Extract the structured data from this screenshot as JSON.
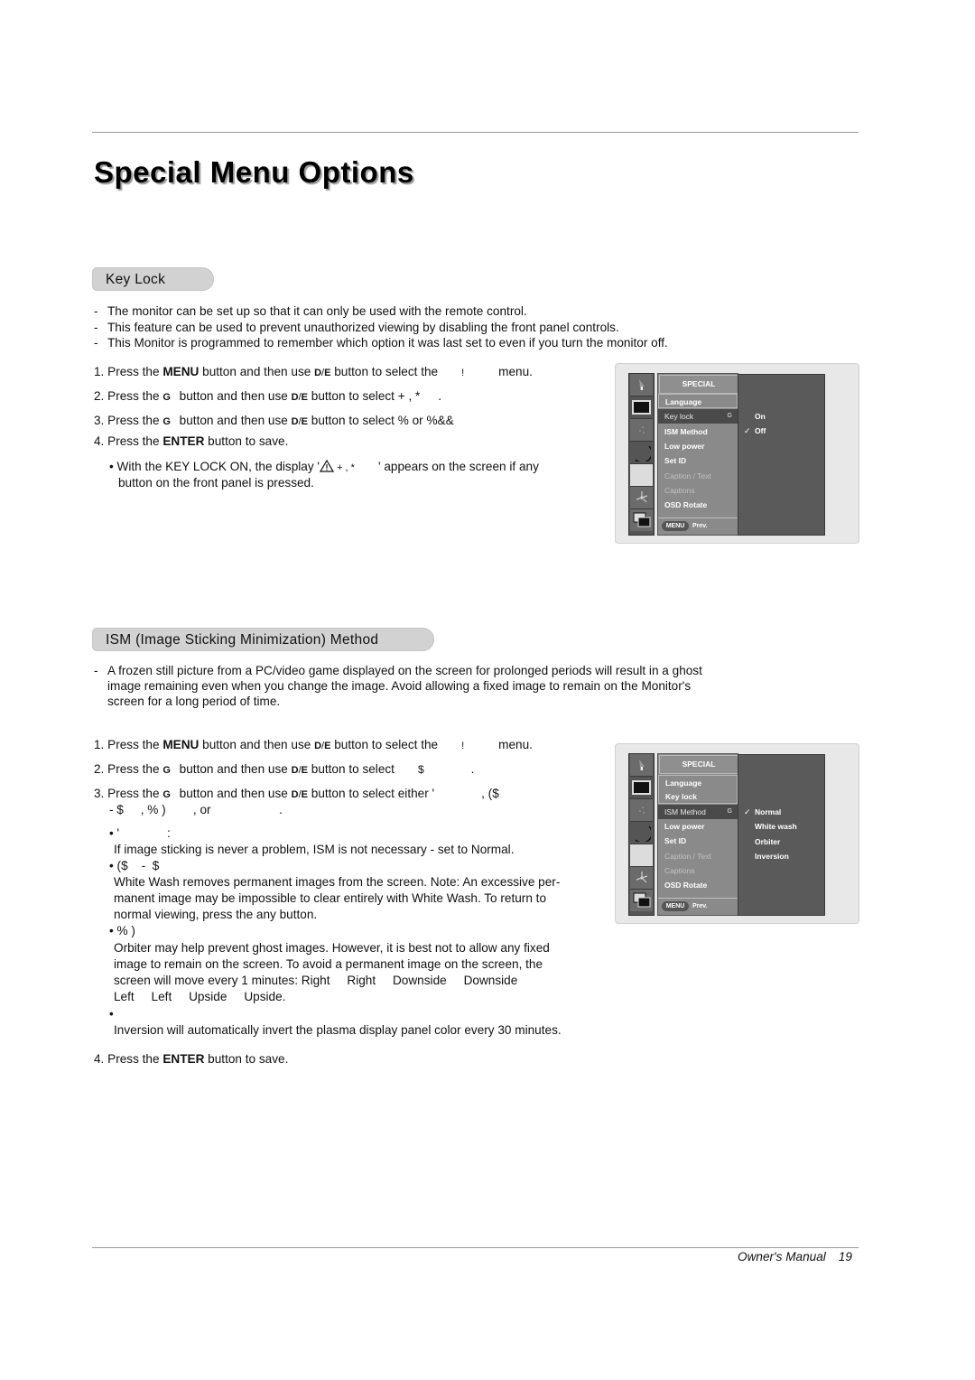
{
  "page": {
    "title": "Special Menu Options",
    "footer_label": "Owner's Manual",
    "page_number": "19"
  },
  "keylock": {
    "heading": "Key Lock",
    "intro": [
      "The monitor can be set up so that it can only be used with the remote control.",
      "This feature can be used to prevent unauthorized viewing by disabling the front panel controls.",
      "This Monitor is programmed to remember which option it was last set to even if you turn the monitor off."
    ],
    "steps": {
      "s1": {
        "num": "1.",
        "a": "Press the ",
        "b": "MENU",
        "c": " button and then use ",
        "k1": "D",
        "sep": " / ",
        "k2": "E",
        "d": " button to select the",
        "e": "!",
        "f": "menu."
      },
      "s2": {
        "num": "2.",
        "a": "Press the ",
        "kg": "G",
        "c": " button and then use ",
        "k1": "D",
        "sep": " / ",
        "k2": "E",
        "d": " button to select + ,   *",
        "f": "."
      },
      "s3": {
        "num": "3.",
        "a": "Press the ",
        "kg": "G",
        "c": " button and then use ",
        "k1": "D",
        "sep": " / ",
        "k2": "E",
        "d": " button to select %   or %&&"
      },
      "s4": {
        "num": "4.",
        "a": "Press the ",
        "b": "ENTER",
        "c": " button to save."
      }
    },
    "note_line1_a": "• With the KEY LOCK ON, the display '",
    "note_line1_b": " + ,   *",
    "note_line1_c": "' appears on the screen if any",
    "note_line2": "button on the front panel is pressed.",
    "osd": {
      "header": "SPECIAL",
      "items": [
        "Language",
        "Key lock",
        "ISM Method",
        "Low power",
        "Set ID",
        "Caption / Text",
        "Captions",
        "OSD Rotate"
      ],
      "selected_marker": "G",
      "options": [
        "On",
        "Off"
      ],
      "checked_option": "Off",
      "check_glyph": "✓",
      "menu_button": "MENU",
      "prev_label": "Prev."
    }
  },
  "ism": {
    "heading": "ISM (Image Sticking Minimization) Method",
    "intro": [
      "A frozen still picture from a PC/video game displayed on the screen for prolonged periods will result in a ghost",
      "image remaining even when you change the image. Avoid allowing a fixed image to remain on the Monitor's",
      "screen for a long period of time."
    ],
    "steps": {
      "s1": {
        "num": "1.",
        "a": "Press the ",
        "b": "MENU",
        "c": " button and then use ",
        "k1": "D",
        "sep": " / ",
        "k2": "E",
        "d": " button to select the",
        "e": "!",
        "f": "menu."
      },
      "s2": {
        "num": "2.",
        "a": "Press the ",
        "kg": "G",
        "c": " button and then use ",
        "k1": "D",
        "sep": " / ",
        "k2": "E",
        "d": " button to select",
        "e": "$",
        "f": "."
      },
      "s3": {
        "num": "3.",
        "a": "Press the ",
        "kg": "G",
        "c": " button and then use ",
        "k1": "D",
        "sep": " / ",
        "k2": "E",
        "d": " button to select either '",
        "e": ", ($"
      },
      "s3_cont": "- $     , % )        , or                    .",
      "s4": {
        "num": "4.",
        "a": "Press the ",
        "b": "ENTER",
        "c": " button to save."
      }
    },
    "bullets": [
      {
        "label": "• '              :",
        "text": [
          "If image sticking is never a problem, ISM is not necessary - set to Normal."
        ]
      },
      {
        "label": "• ($    -  $",
        "text": [
          "White Wash removes permanent images from the screen. Note: An excessive per-",
          "manent image may be impossible to clear entirely with White Wash. To return to",
          "normal viewing, press the any button."
        ]
      },
      {
        "label": "• % )",
        "text": [
          "Orbiter may help prevent ghost images. However, it is best not to allow any fixed",
          "image to remain on the screen. To avoid a permanent image on the screen, the",
          "screen will move every 1 minutes: Right     Right     Downside     Downside",
          "Left     Left     Upside     Upside."
        ]
      },
      {
        "label": "•",
        "text": [
          "Inversion will automatically invert the plasma display panel color every 30 minutes."
        ]
      }
    ],
    "osd": {
      "header": "SPECIAL",
      "items": [
        "Language",
        "Key lock",
        "ISM Method",
        "Low power",
        "Set ID",
        "Caption / Text",
        "Captions",
        "OSD Rotate"
      ],
      "selected_marker": "G",
      "options": [
        "Normal",
        "White wash",
        "Orbiter",
        "Inversion"
      ],
      "checked_option": "Normal",
      "check_glyph": "✓",
      "menu_button": "MENU",
      "prev_label": "Prev."
    }
  },
  "icons": [
    "cursor-icon",
    "picture-icon",
    "sparkle-icon",
    "moon-icon",
    "blank-icon",
    "fan-icon",
    "pip-icon"
  ]
}
